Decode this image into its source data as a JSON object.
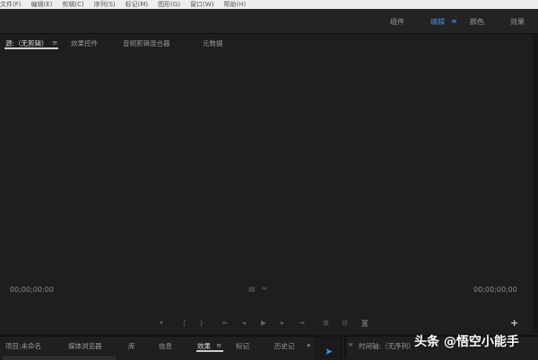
{
  "menu": [
    "文件(F)",
    "编辑(E)",
    "剪辑(C)",
    "序列(S)",
    "标记(M)",
    "图形(G)",
    "窗口(W)",
    "帮助(H)"
  ],
  "workspaces": {
    "items": [
      "组件",
      "编辑",
      "颜色",
      "效果"
    ],
    "active": "编辑",
    "menu_glyph": "≡"
  },
  "source_panel": {
    "tabs": [
      "源:（无剪辑）",
      "效果控件",
      "音频剪辑混合器",
      "元数据"
    ],
    "menu_glyph": "≡",
    "timecode_left": "00;00;00;00",
    "timecode_right": "00;00;00;00",
    "add_glyph": "+"
  },
  "bottom_panel": {
    "tabs": [
      "项目:未命名",
      "媒体浏览器",
      "库",
      "信息",
      "效果",
      "标记",
      "历史记"
    ],
    "active": "效果",
    "overflow": "»"
  },
  "timeline": {
    "close": "×",
    "title": "时间轴:（无序列）"
  },
  "watermark": "头条 @悟空小能手",
  "colors": {
    "accent": "#3d8ee0",
    "background": "#1e1e1e"
  }
}
